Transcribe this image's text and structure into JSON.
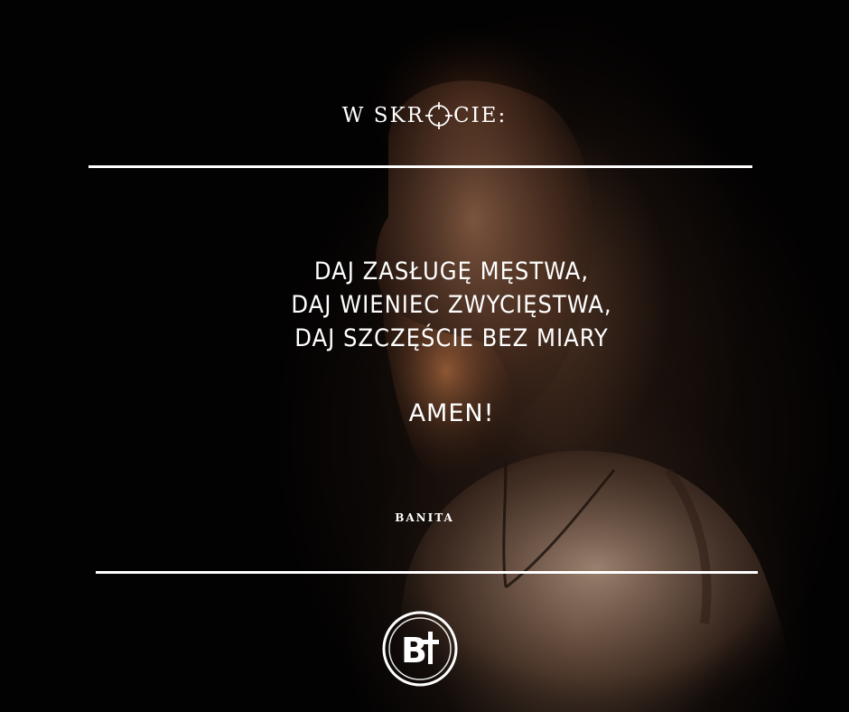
{
  "header": {
    "title_before": "W SKR",
    "title_after": "CIE:",
    "title_icon": "crosshair-icon"
  },
  "quote": {
    "lines": [
      "DAJ ZASŁUGĘ MĘSTWA,",
      "DAJ WIENIEC ZWYCIĘSTWA,",
      "DAJ SZCZĘŚCIE BEZ MIARY"
    ],
    "closing": "AMEN!",
    "author": "BANITA"
  },
  "logo": {
    "text": "B+",
    "icon": "cross-icon"
  },
  "colors": {
    "text": "#ffffff",
    "background": "#000000",
    "skin": "#8a5a3f"
  }
}
